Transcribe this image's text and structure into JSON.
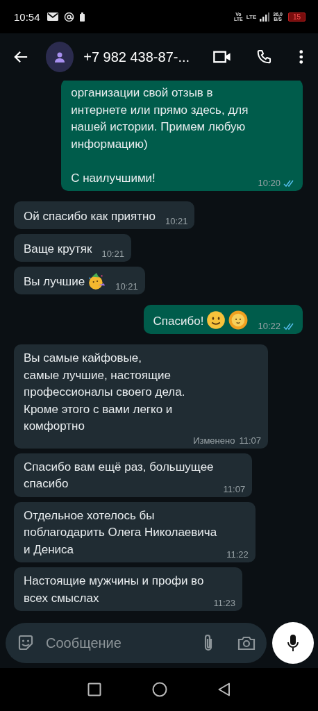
{
  "status_bar": {
    "time": "10:54",
    "volte": [
      "Vo",
      "LTE"
    ],
    "network": "LTE",
    "speed": [
      "36,0",
      "B/S"
    ],
    "battery": "15",
    "battery_low": true
  },
  "header": {
    "title": "+7 982 438-87-..."
  },
  "messages": [
    {
      "kind": "outgoing",
      "text": "организации свой отзыв в\nинтернете или прямо здесь, для\nнашей истории. Примем любую\nинформацию)\n\nС наилучшими!",
      "time": "10:20",
      "read": true
    },
    {
      "kind": "incoming",
      "text": "Ой спасибо как приятно",
      "time": "10:21"
    },
    {
      "kind": "incoming",
      "text": "Ваще крутяк",
      "time": "10:21"
    },
    {
      "kind": "incoming",
      "text": "Вы лучшие",
      "emojis": [
        {
          "kind": "party"
        }
      ],
      "time": "10:21"
    },
    {
      "kind": "outgoing",
      "text": "Спасибо!",
      "emojis": [
        {
          "kind": "smile"
        },
        {
          "kind": "sun"
        }
      ],
      "time": "10:22",
      "read": true
    },
    {
      "kind": "incoming",
      "text": "Вы самые кайфовые,\nсамые лучшие, настоящие\nпрофессионалы своего дела.\nКроме этого с вами легко и\nкомфортно",
      "edited": "Изменено",
      "time": "11:07"
    },
    {
      "kind": "incoming",
      "text": "Спасибо вам ещё раз, большущее\nспасибо",
      "time": "11:07"
    },
    {
      "kind": "incoming",
      "text": "Отдельное хотелось бы\nпоблагодарить Олега Николаевича\nи Дениса",
      "time": "11:22"
    },
    {
      "kind": "incoming",
      "text": "Настоящие мужчины и профи во\nвсех смыслах",
      "time": "11:23"
    }
  ],
  "composer": {
    "placeholder": "Сообщение"
  }
}
